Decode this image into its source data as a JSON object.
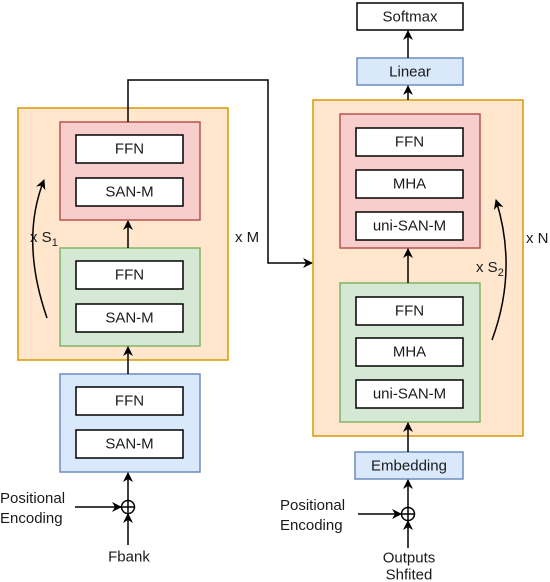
{
  "encoder": {
    "repeat_label": "x M",
    "inner_repeat_label": "x S",
    "inner_repeat_sub": "1",
    "pink_block": [
      "FFN",
      "SAN-M"
    ],
    "green_block": [
      "FFN",
      "SAN-M"
    ],
    "input_block": [
      "FFN",
      "SAN-M"
    ],
    "positional_encoding": [
      "Positional",
      "Encoding"
    ],
    "input": "Fbank"
  },
  "decoder": {
    "repeat_label": "x N",
    "inner_repeat_label": "x S",
    "inner_repeat_sub": "2",
    "pink_block": [
      "FFN",
      "MHA",
      "uni-SAN-M"
    ],
    "green_block": [
      "FFN",
      "MHA",
      "uni-SAN-M"
    ],
    "embedding": "Embedding",
    "linear": "Linear",
    "softmax": "Softmax",
    "positional_encoding": [
      "Positional",
      "Encoding"
    ],
    "input": [
      "Outputs",
      "Shfited"
    ]
  },
  "colors": {
    "orange_fill": "#ffe6cc",
    "orange_stroke": "#d79b00",
    "pink_fill": "#f8cecc",
    "pink_stroke": "#b85450",
    "green_fill": "#d5e8d4",
    "green_stroke": "#82b366",
    "blue_fill": "#dae8fc",
    "blue_stroke": "#6c8ebf"
  }
}
